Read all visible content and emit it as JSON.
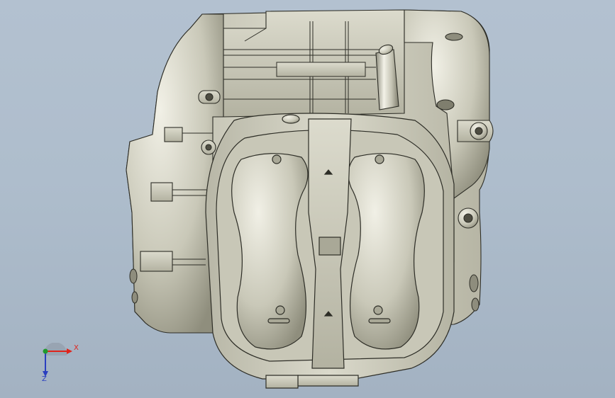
{
  "colors": {
    "background_top": "#b3c1d0",
    "background_bottom": "#a3b2c2",
    "part_fill": "#d4d3c4",
    "part_shade": "#a9a897",
    "edge": "#2d2d26",
    "axis_x": "#e0241c",
    "axis_y": "#1f9a2c",
    "axis_z": "#2a3fc0"
  },
  "view": {
    "model": "engine-assembly",
    "orientation": "top"
  },
  "triad": {
    "x_label": "X",
    "z_label": "Z"
  }
}
